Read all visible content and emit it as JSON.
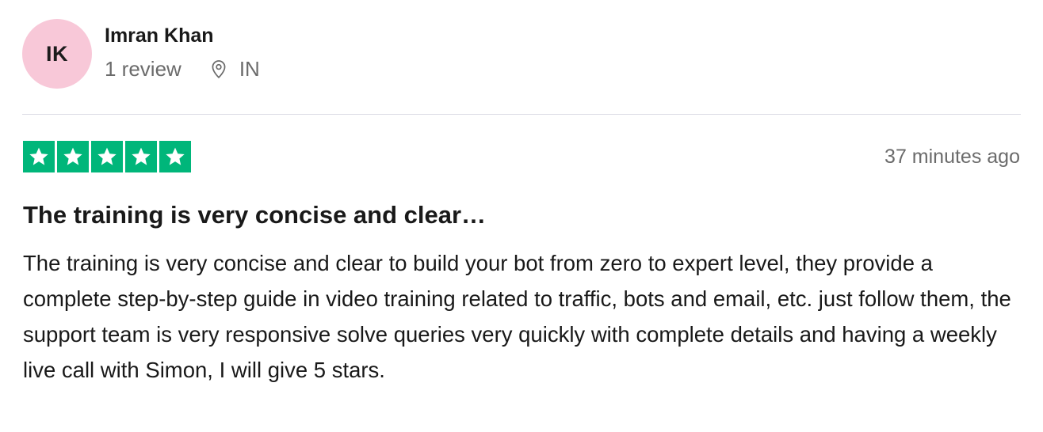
{
  "consumer": {
    "initials": "IK",
    "name": "Imran Khan",
    "review_count": "1 review",
    "location_icon": "location-pin-icon",
    "country": "IN",
    "avatar_color": "#f8c8d8"
  },
  "review": {
    "rating": 5,
    "rating_max": 5,
    "star_color": "#00b67a",
    "date": "37 minutes ago",
    "title": "The training is very concise and clear…",
    "body": "The training is very concise and clear to build your bot from zero to expert level, they provide a complete step-by-step guide in video training related to traffic, bots and email, etc. just follow them, the support team is very responsive solve queries very quickly with complete details and having a weekly live call with Simon, I will give 5 stars."
  }
}
